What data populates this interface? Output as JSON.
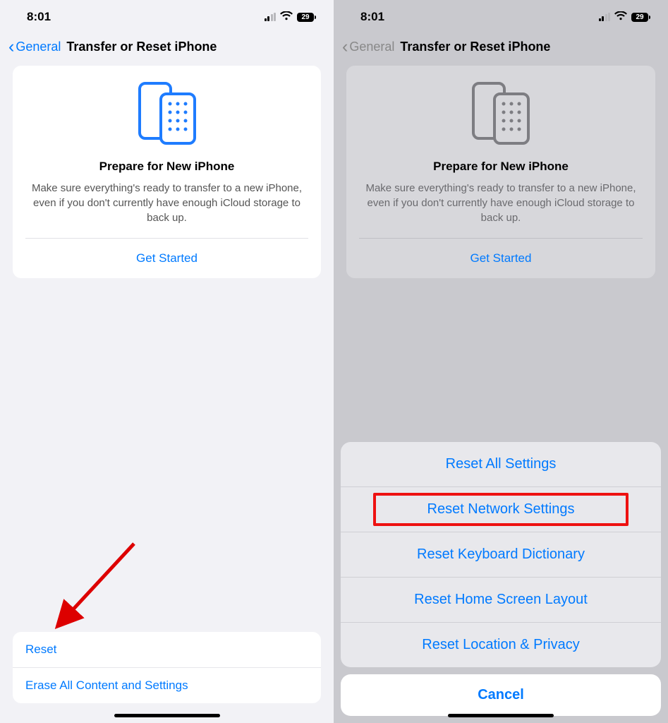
{
  "status": {
    "time": "8:01",
    "battery": "29"
  },
  "nav": {
    "back": "General",
    "title": "Transfer or Reset iPhone"
  },
  "prepare": {
    "title": "Prepare for New iPhone",
    "desc": "Make sure everything's ready to transfer to a new iPhone, even if you don't currently have enough iCloud storage to back up.",
    "cta": "Get Started"
  },
  "bottom": {
    "reset": "Reset",
    "erase": "Erase All Content and Settings"
  },
  "sheet": {
    "items": [
      "Reset All Settings",
      "Reset Network Settings",
      "Reset Keyboard Dictionary",
      "Reset Home Screen Layout",
      "Reset Location & Privacy"
    ],
    "cancel": "Cancel",
    "highlighted_index": 1
  }
}
